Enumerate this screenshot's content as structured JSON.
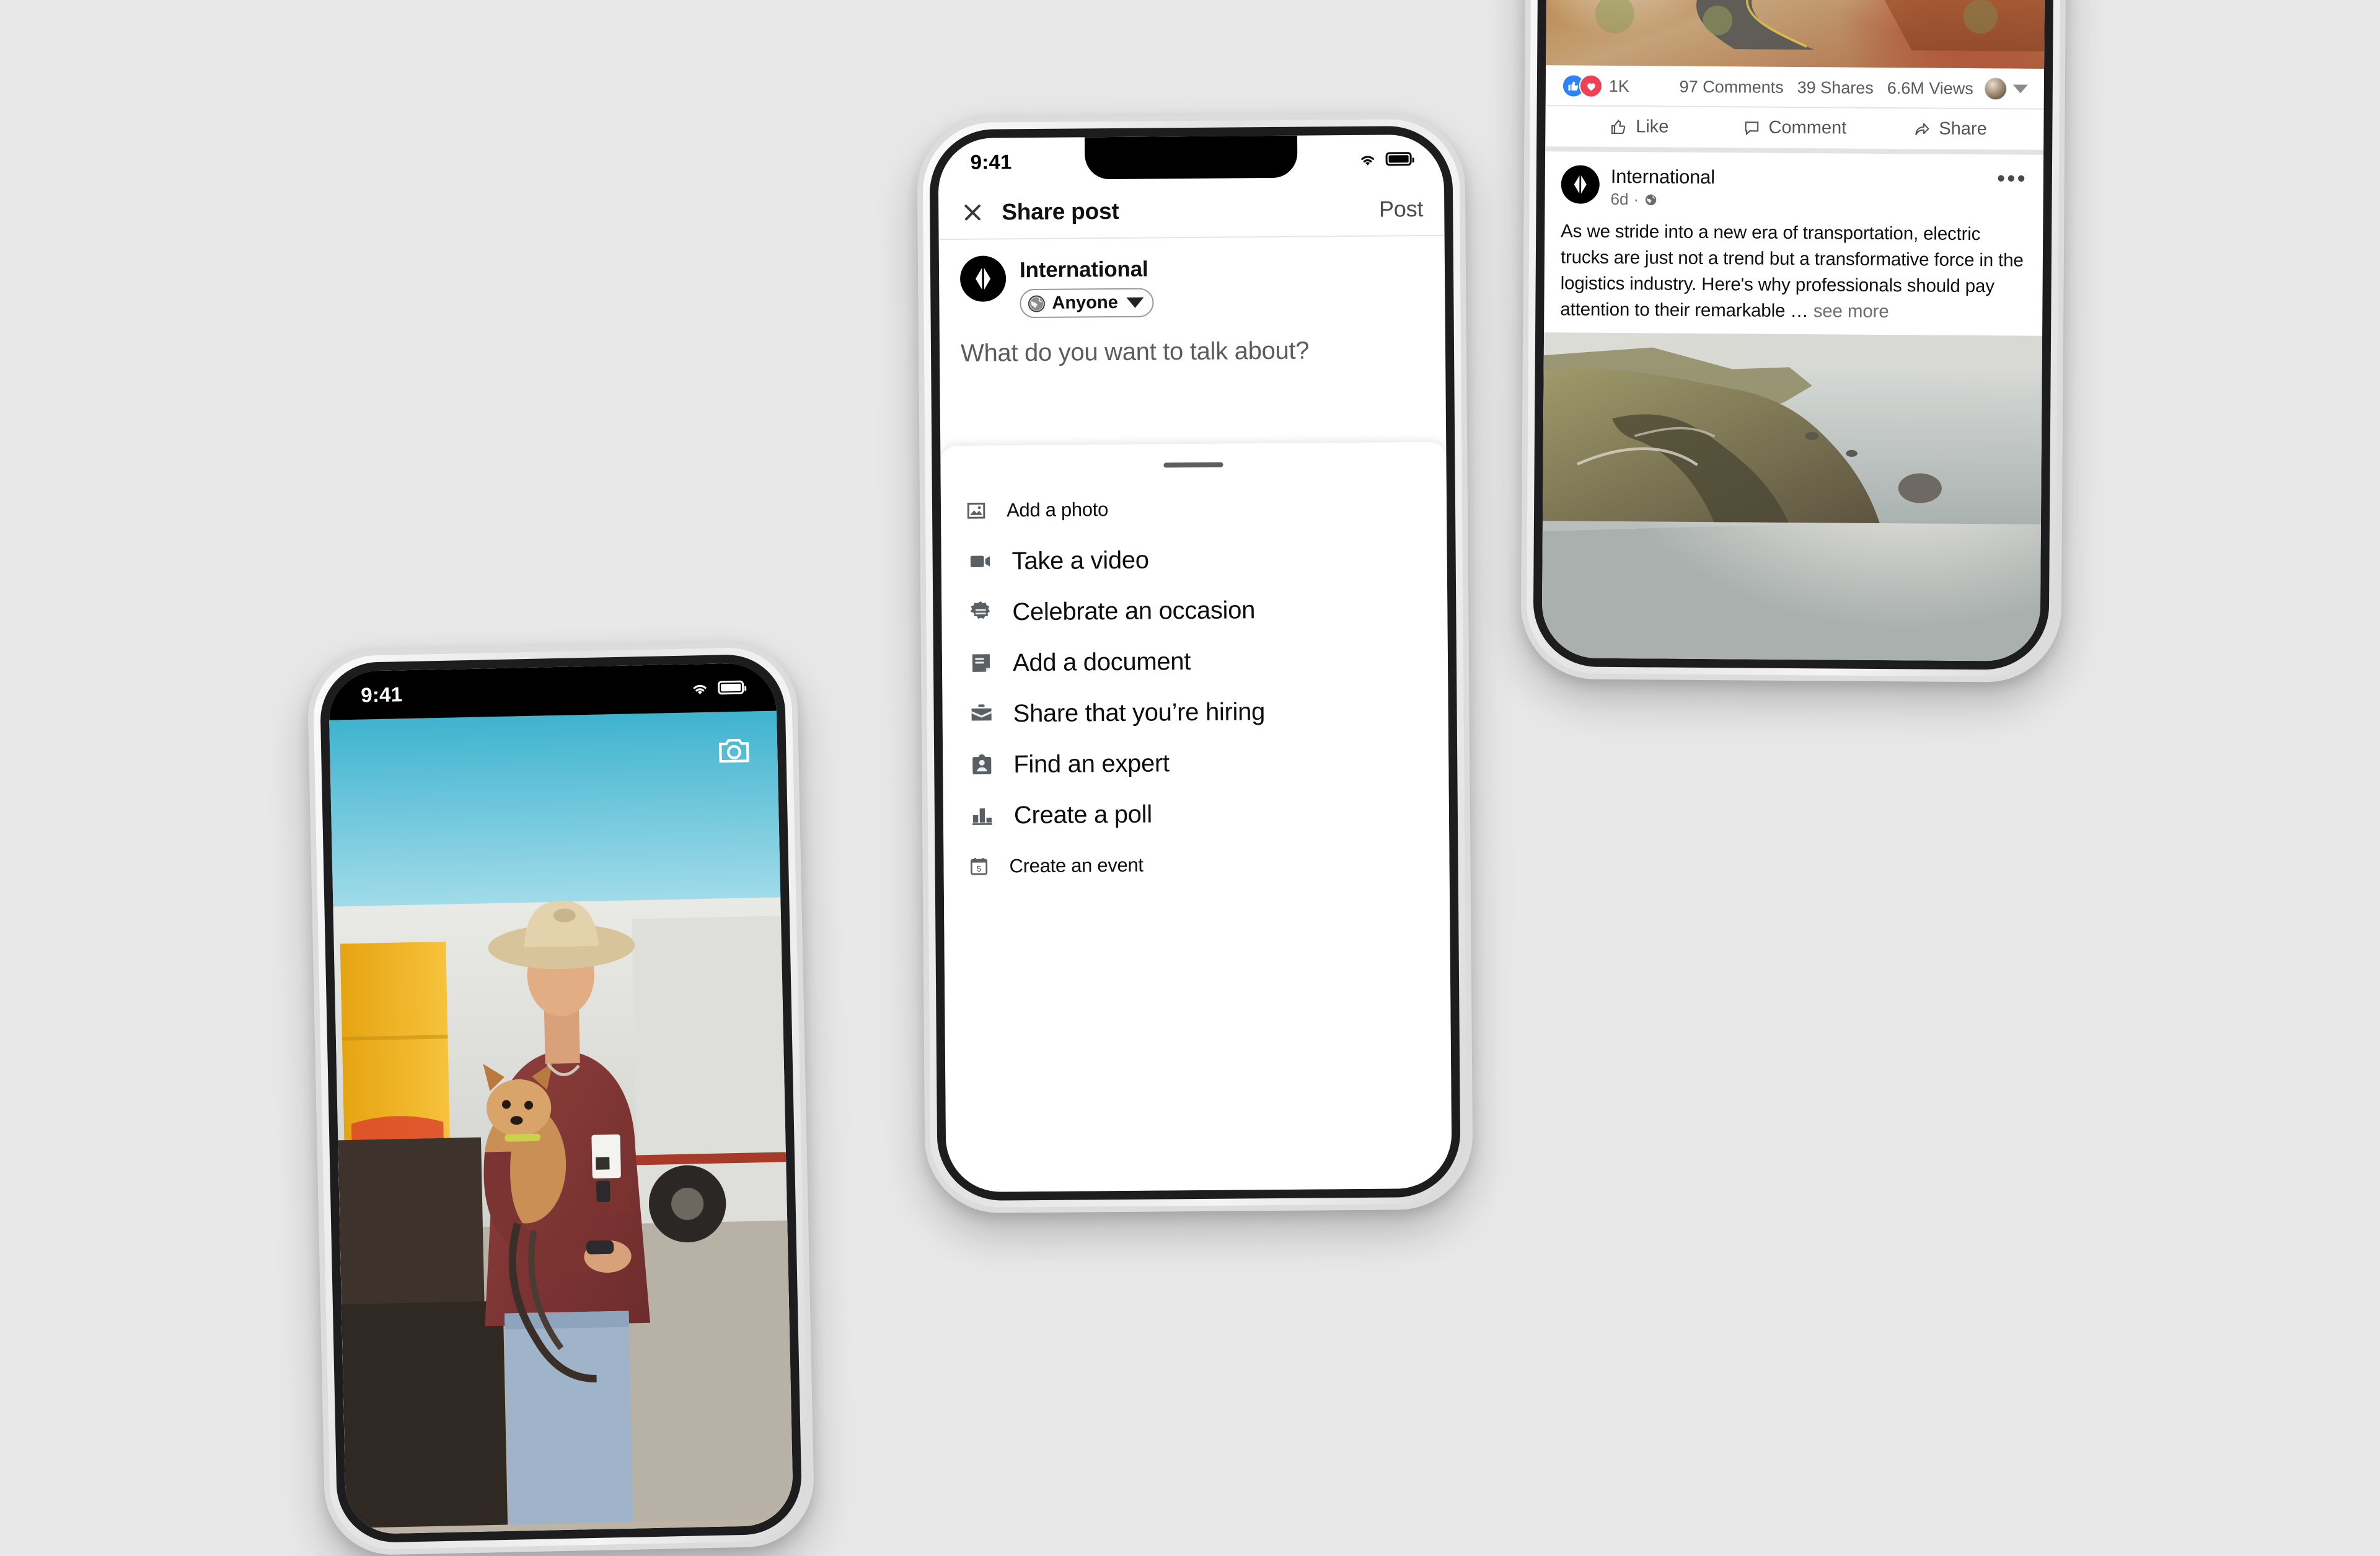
{
  "background_color": "#e8e8e8",
  "phone_center": {
    "status_bar": {
      "time": "9:41",
      "wifi_icon": "wifi-icon",
      "battery_icon": "battery-icon"
    },
    "header": {
      "close_icon": "close-icon",
      "title": "Share post",
      "post_label": "Post"
    },
    "author": {
      "avatar_icon": "international-logo-icon",
      "name": "International",
      "audience": {
        "globe_icon": "globe-icon",
        "label": "Anyone",
        "caret_icon": "chevron-down-icon"
      }
    },
    "composer": {
      "placeholder": "What do you want to talk about?"
    },
    "sheet": {
      "grabber_icon": "drag-handle-icon",
      "items": [
        {
          "icon": "photo-icon",
          "label": "Add a photo"
        },
        {
          "icon": "video-icon",
          "label": "Take a video"
        },
        {
          "icon": "celebrate-icon",
          "label": "Celebrate an occasion"
        },
        {
          "icon": "document-icon",
          "label": "Add a document"
        },
        {
          "icon": "briefcase-icon",
          "label": "Share that you’re hiring"
        },
        {
          "icon": "expert-badge-icon",
          "label": "Find an expert"
        },
        {
          "icon": "poll-bars-icon",
          "label": "Create a poll"
        },
        {
          "icon": "calendar-icon",
          "label": "Create an event"
        }
      ]
    }
  },
  "phone_right": {
    "media_top": {
      "alt": "winding desert canyon road with truck",
      "icon": "road-photo"
    },
    "stats": {
      "like_icon": "thumbs-up-reaction-icon",
      "love_icon": "heart-reaction-icon",
      "reaction_count": "1K",
      "comments": "97 Comments",
      "shares": "39 Shares",
      "views": "6.6M Views",
      "avatar_icon": "viewer-avatar",
      "caret_icon": "chevron-down-icon"
    },
    "actions": [
      {
        "icon": "thumbs-up-outline-icon",
        "label": "Like"
      },
      {
        "icon": "comment-bubble-icon",
        "label": "Comment"
      },
      {
        "icon": "share-arrow-icon",
        "label": "Share"
      }
    ],
    "post": {
      "avatar_icon": "international-logo-icon",
      "author": "International",
      "age": "6d",
      "dot": "·",
      "visibility_icon": "globe-icon",
      "more_icon": "overflow-menu-icon",
      "body": "As we stride into a new era of transportation, electric trucks are just not a trend but a transformative force in the logistics industry. Here's why professionals should pay attention to their remarkable ",
      "ellipsis": "… ",
      "see_more": "see more",
      "media_bottom": {
        "alt": "coastal cliff highway over ocean",
        "icon": "coast-photo"
      }
    }
  },
  "phone_left": {
    "status_bar": {
      "time": "9:41",
      "wifi_icon": "wifi-icon",
      "battery_icon": "battery-icon"
    },
    "camera_icon": "camera-icon",
    "photo": {
      "alt": "man in cowboy hat holding small dog in front of trucks"
    }
  }
}
